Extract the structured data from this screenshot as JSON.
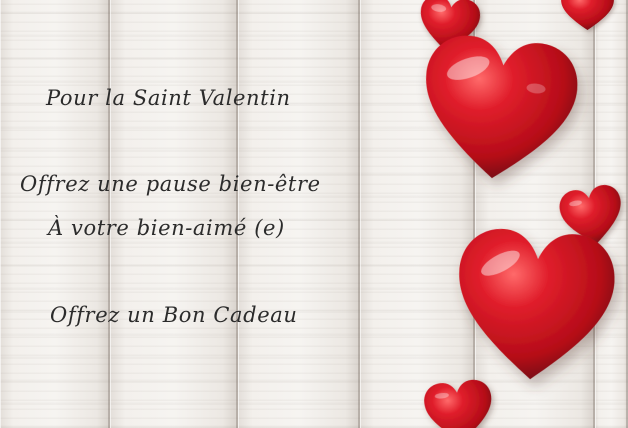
{
  "message": {
    "line1": "Pour la Saint Valentin",
    "line2": "Offrez une pause bien-être",
    "line3": "À votre bien-aimé (e)",
    "line4": "Offrez un Bon Cadeau"
  },
  "colors": {
    "heart_red": "#c8101e",
    "heart_dark": "#8e0a14",
    "wood": "#efece8",
    "text": "#2b2b2b"
  },
  "decorations": [
    "red-heart",
    "wood-planks"
  ]
}
